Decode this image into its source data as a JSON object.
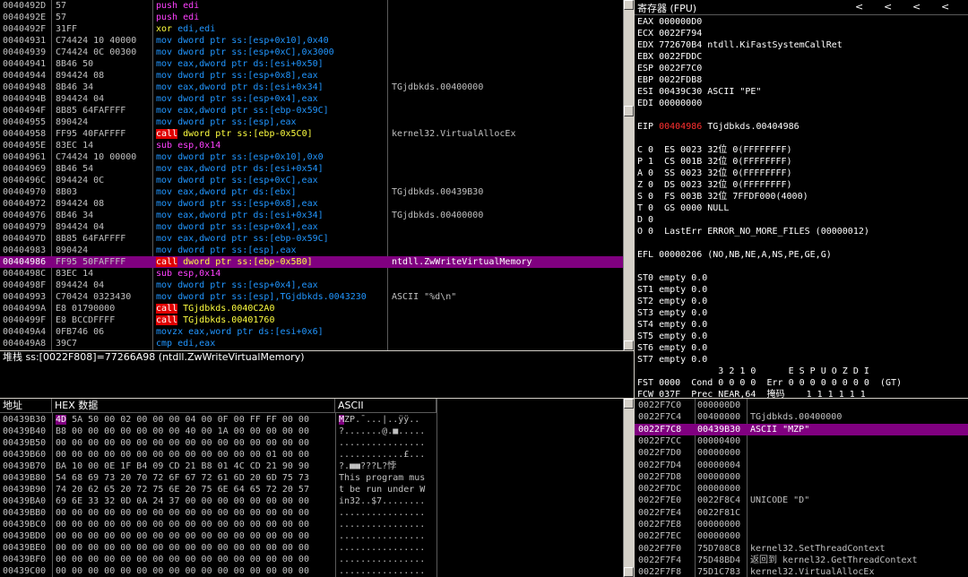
{
  "disasm": {
    "rows": [
      {
        "addr": "0040492D",
        "hex": "57",
        "asm": "push edi",
        "comment": ""
      },
      {
        "addr": "0040492E",
        "hex": "57",
        "asm": "push edi",
        "comment": ""
      },
      {
        "addr": "0040492F",
        "hex": "31FF",
        "asm": "xor edi,edi",
        "comment": ""
      },
      {
        "addr": "00404931",
        "hex": "C74424 10 40000",
        "asm": "mov dword ptr ss:[esp+0x10],0x40",
        "comment": ""
      },
      {
        "addr": "00404939",
        "hex": "C74424 0C 00300",
        "asm": "mov dword ptr ss:[esp+0xC],0x3000",
        "comment": ""
      },
      {
        "addr": "00404941",
        "hex": "8B46 50",
        "asm": "mov eax,dword ptr ds:[esi+0x50]",
        "comment": ""
      },
      {
        "addr": "00404944",
        "hex": "894424 08",
        "asm": "mov dword ptr ss:[esp+0x8],eax",
        "comment": ""
      },
      {
        "addr": "00404948",
        "hex": "8B46 34",
        "asm": "mov eax,dword ptr ds:[esi+0x34]",
        "comment": "TGjdbkds.00400000"
      },
      {
        "addr": "0040494B",
        "hex": "894424 04",
        "asm": "mov dword ptr ss:[esp+0x4],eax",
        "comment": ""
      },
      {
        "addr": "0040494F",
        "hex": "8B85 64FAFFFF",
        "asm": "mov eax,dword ptr ss:[ebp-0x59C]",
        "comment": ""
      },
      {
        "addr": "00404955",
        "hex": "890424",
        "asm": "mov dword ptr ss:[esp],eax",
        "comment": ""
      },
      {
        "addr": "00404958",
        "hex": "FF95 40FAFFFF",
        "asm": "call dword ptr ss:[ebp-0x5C0]",
        "comment": "kernel32.VirtualAllocEx"
      },
      {
        "addr": "0040495E",
        "hex": "83EC 14",
        "asm": "sub esp,0x14",
        "comment": ""
      },
      {
        "addr": "00404961",
        "hex": "C74424 10 00000",
        "asm": "mov dword ptr ss:[esp+0x10],0x0",
        "comment": ""
      },
      {
        "addr": "00404969",
        "hex": "8B46 54",
        "asm": "mov eax,dword ptr ds:[esi+0x54]",
        "comment": ""
      },
      {
        "addr": "0040496C",
        "hex": "894424 0C",
        "asm": "mov dword ptr ss:[esp+0xC],eax",
        "comment": ""
      },
      {
        "addr": "00404970",
        "hex": "8B03",
        "asm": "mov eax,dword ptr ds:[ebx]",
        "comment": "TGjdbkds.00439B30"
      },
      {
        "addr": "00404972",
        "hex": "894424 08",
        "asm": "mov dword ptr ss:[esp+0x8],eax",
        "comment": ""
      },
      {
        "addr": "00404976",
        "hex": "8B46 34",
        "asm": "mov eax,dword ptr ds:[esi+0x34]",
        "comment": "TGjdbkds.00400000"
      },
      {
        "addr": "00404979",
        "hex": "894424 04",
        "asm": "mov dword ptr ss:[esp+0x4],eax",
        "comment": ""
      },
      {
        "addr": "0040497D",
        "hex": "8B85 64FAFFFF",
        "asm": "mov eax,dword ptr ss:[ebp-0x59C]",
        "comment": ""
      },
      {
        "addr": "00404983",
        "hex": "890424",
        "asm": "mov dword ptr ss:[esp],eax",
        "comment": ""
      },
      {
        "addr": "00404986",
        "hex": "FF95 50FAFFFF",
        "asm": "call dword ptr ss:[ebp-0x5B0]",
        "comment": "ntdll.ZwWriteVirtualMemory"
      },
      {
        "addr": "0040498C",
        "hex": "83EC 14",
        "asm": "sub esp,0x14",
        "comment": ""
      },
      {
        "addr": "0040498F",
        "hex": "894424 04",
        "asm": "mov dword ptr ss:[esp+0x4],eax",
        "comment": ""
      },
      {
        "addr": "00404993",
        "hex": "C70424 0323430",
        "asm": "mov dword ptr ss:[esp],TGjdbkds.0043230",
        "comment": "ASCII \"%d\\n\""
      },
      {
        "addr": "0040499A",
        "hex": "E8 01790000",
        "asm": "call TGjdbkds.0040C2A0",
        "comment": ""
      },
      {
        "addr": "0040499F",
        "hex": "E8 BCCDFFFF",
        "asm": "call TGjdbkds.00401760",
        "comment": ""
      },
      {
        "addr": "004049A4",
        "hex": "0FB746 06",
        "asm": "movzx eax,word ptr ds:[esi+0x6]",
        "comment": ""
      },
      {
        "addr": "004049A8",
        "hex": "39C7",
        "asm": "cmp edi,eax",
        "comment": ""
      }
    ],
    "selected_index": 22,
    "info_line": "堆栈 ss:[0022F808]=77266A98 (ntdll.ZwWriteVirtualMemory)"
  },
  "registers": {
    "title": "寄存器 (FPU)",
    "nav": [
      "<",
      "<",
      "<",
      "<",
      "<"
    ],
    "lines": [
      "EAX 000000D0",
      "ECX 0022F794",
      "EDX 772670B4 ntdll.KiFastSystemCallRet",
      "EBX 0022FDDC",
      "ESP 0022F7C0",
      "EBP 0022FDB8",
      "ESI 00439C30 ASCII \"PE\"",
      "EDI 00000000",
      "",
      "EIP 00404986 TGjdbkds.00404986",
      "",
      "C 0  ES 0023 32位 0(FFFFFFFF)",
      "P 1  CS 001B 32位 0(FFFFFFFF)",
      "A 0  SS 0023 32位 0(FFFFFFFF)",
      "Z 0  DS 0023 32位 0(FFFFFFFF)",
      "S 0  FS 003B 32位 7FFDF000(4000)",
      "T 0  GS 0000 NULL",
      "D 0",
      "O 0  LastErr ERROR_NO_MORE_FILES (00000012)",
      "",
      "EFL 00000206 (NO,NB,NE,A,NS,PE,GE,G)",
      "",
      "ST0 empty 0.0",
      "ST1 empty 0.0",
      "ST2 empty 0.0",
      "ST3 empty 0.0",
      "ST4 empty 0.0",
      "ST5 empty 0.0",
      "ST6 empty 0.0",
      "ST7 empty 0.0",
      "               3 2 1 0      E S P U O Z D I",
      "FST 0000  Cond 0 0 0 0  Err 0 0 0 0 0 0 0 0  (GT)",
      "FCW 037F  Prec NEAR,64  掩码    1 1 1 1 1 1"
    ]
  },
  "dump": {
    "headers": {
      "address": "地址",
      "hex": "HEX 数据",
      "ascii": "ASCII"
    },
    "rows": [
      {
        "addr": "00439B30",
        "hex": "4D 5A 50 00 02 00 00 00 04 00 0F 00 FF FF 00 00",
        "ascii": "MZP.¯...|..ÿÿ.."
      },
      {
        "addr": "00439B40",
        "hex": "B8 00 00 00 00 00 00 00 40 00 1A 00 00 00 00 00",
        "ascii": "?.......@.■....."
      },
      {
        "addr": "00439B50",
        "hex": "00 00 00 00 00 00 00 00 00 00 00 00 00 00 00 00",
        "ascii": "................"
      },
      {
        "addr": "00439B60",
        "hex": "00 00 00 00 00 00 00 00 00 00 00 00 00 01 00 00",
        "ascii": "............£..."
      },
      {
        "addr": "00439B70",
        "hex": "BA 10 00 0E 1F B4 09 CD 21 B8 01 4C CD 21 90 90",
        "ascii": "?.■■???L?悖"
      },
      {
        "addr": "00439B80",
        "hex": "54 68 69 73 20 70 72 6F 67 72 61 6D 20 6D 75 73",
        "ascii": "This program mus"
      },
      {
        "addr": "00439B90",
        "hex": "74 20 62 65 20 72 75 6E 20 75 6E 64 65 72 20 57",
        "ascii": "t be run under W"
      },
      {
        "addr": "00439BA0",
        "hex": "69 6E 33 32 0D 0A 24 37 00 00 00 00 00 00 00 00",
        "ascii": "in32..$7........"
      },
      {
        "addr": "00439BB0",
        "hex": "00 00 00 00 00 00 00 00 00 00 00 00 00 00 00 00",
        "ascii": "................"
      },
      {
        "addr": "00439BC0",
        "hex": "00 00 00 00 00 00 00 00 00 00 00 00 00 00 00 00",
        "ascii": "................"
      },
      {
        "addr": "00439BD0",
        "hex": "00 00 00 00 00 00 00 00 00 00 00 00 00 00 00 00",
        "ascii": "................"
      },
      {
        "addr": "00439BE0",
        "hex": "00 00 00 00 00 00 00 00 00 00 00 00 00 00 00 00",
        "ascii": "................"
      },
      {
        "addr": "00439BF0",
        "hex": "00 00 00 00 00 00 00 00 00 00 00 00 00 00 00 00",
        "ascii": "................"
      },
      {
        "addr": "00439C00",
        "hex": "00 00 00 00 00 00 00 00 00 00 00 00 00 00 00 00",
        "ascii": "................"
      }
    ]
  },
  "stack": {
    "rows": [
      {
        "addr": "0022F7C0",
        "val": "000000D0",
        "comment": ""
      },
      {
        "addr": "0022F7C4",
        "val": "00400000",
        "comment": "TGjdbkds.00400000"
      },
      {
        "addr": "0022F7C8",
        "val": "00439B30",
        "comment": "ASCII \"MZP\""
      },
      {
        "addr": "0022F7CC",
        "val": "00000400",
        "comment": ""
      },
      {
        "addr": "0022F7D0",
        "val": "00000000",
        "comment": ""
      },
      {
        "addr": "0022F7D4",
        "val": "00000004",
        "comment": ""
      },
      {
        "addr": "0022F7D8",
        "val": "00000000",
        "comment": ""
      },
      {
        "addr": "0022F7DC",
        "val": "00000000",
        "comment": ""
      },
      {
        "addr": "0022F7E0",
        "val": "0022F8C4",
        "comment": "UNICODE \"D\""
      },
      {
        "addr": "0022F7E4",
        "val": "0022F81C",
        "comment": ""
      },
      {
        "addr": "0022F7E8",
        "val": "00000000",
        "comment": ""
      },
      {
        "addr": "0022F7EC",
        "val": "00000000",
        "comment": ""
      },
      {
        "addr": "0022F7F0",
        "val": "75D708C8",
        "comment": "kernel32.SetThreadContext"
      },
      {
        "addr": "0022F7F4",
        "val": "75D48BD4",
        "comment": "返回到 kernel32.GetThreadContext"
      },
      {
        "addr": "0022F7F8",
        "val": "75D1C783",
        "comment": "kernel32.VirtualAllocEx"
      }
    ],
    "selected_index": 2
  },
  "colors": {
    "selection": "#800080",
    "jump_red": "#e00000",
    "keyword_blue": "#2196ff",
    "addr_cyan": "#00d0d0",
    "eip_red": "#ff3030"
  }
}
